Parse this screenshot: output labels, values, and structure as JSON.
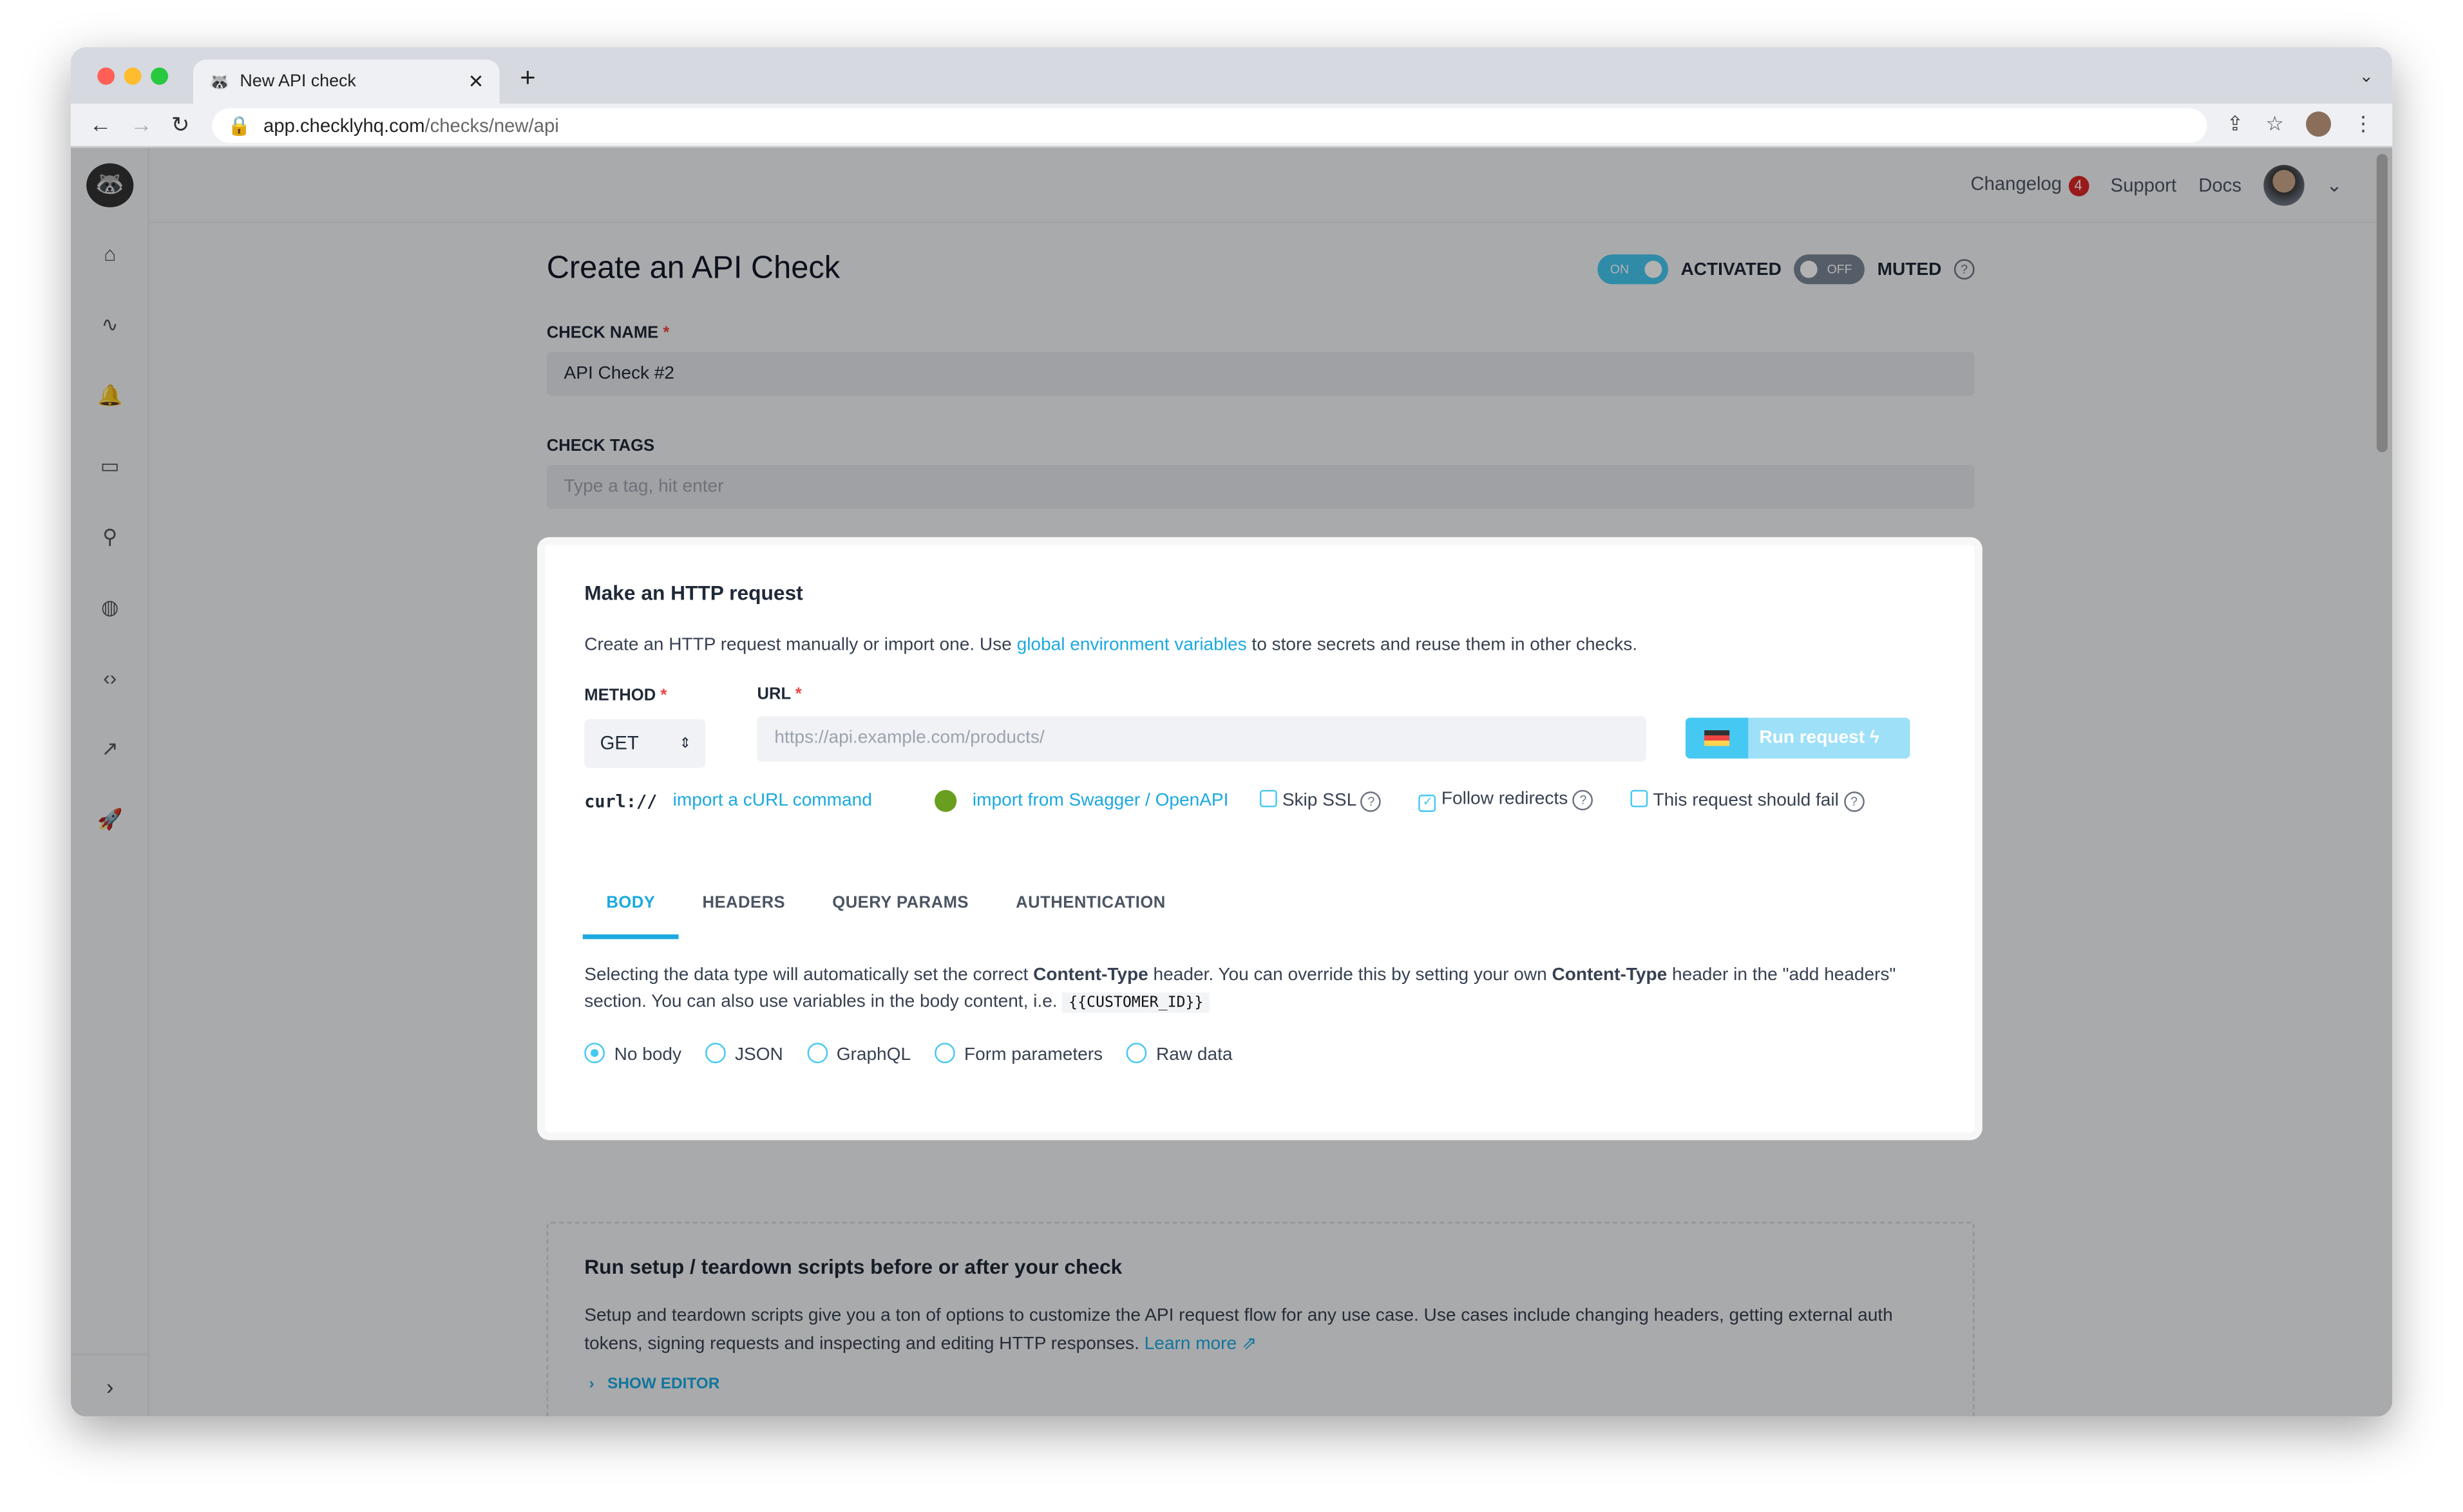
{
  "browser": {
    "tab_title": "New API check",
    "url_host": "app.checklyhq.com",
    "url_path": "/checks/new/api"
  },
  "topbar": {
    "changelog": "Changelog",
    "changelog_count": "4",
    "support": "Support",
    "docs": "Docs"
  },
  "page": {
    "title": "Create an API Check",
    "activated_toggle": "ON",
    "activated_label": "ACTIVATED",
    "muted_toggle": "OFF",
    "muted_label": "MUTED",
    "check_name_label": "CHECK NAME",
    "check_name_value": "API Check #2",
    "check_tags_label": "CHECK TAGS",
    "check_tags_placeholder": "Type a tag, hit enter"
  },
  "http": {
    "title": "Make an HTTP request",
    "desc_pre": "Create an HTTP request manually or import one. Use ",
    "desc_link": "global environment variables",
    "desc_post": " to store secrets and reuse them in other checks.",
    "method_label": "METHOD",
    "method_value": "GET",
    "url_label": "URL",
    "url_placeholder": "https://api.example.com/products/",
    "run_label": "Run request",
    "curl_logo": "curl://",
    "import_curl": "import a cURL command",
    "import_swagger": "import from Swagger / OpenAPI",
    "skip_ssl": "Skip SSL",
    "skip_ssl_checked": false,
    "follow_redirects": "Follow redirects",
    "follow_redirects_checked": true,
    "should_fail": "This request should fail",
    "should_fail_checked": false,
    "tabs": [
      "BODY",
      "HEADERS",
      "QUERY PARAMS",
      "AUTHENTICATION"
    ],
    "active_tab": "BODY",
    "body_p1": "Selecting the data type will automatically set the correct ",
    "body_b1": "Content-Type",
    "body_p2": " header. You can override this by setting your own ",
    "body_b2": "Content-Type",
    "body_p3": " header in the \"add headers\" section. You can also use variables in the body content, i.e. ",
    "body_code": "{{CUSTOMER_ID}}",
    "body_types": [
      "No body",
      "JSON",
      "GraphQL",
      "Form parameters",
      "Raw data"
    ],
    "selected_body_type": "No body"
  },
  "setup": {
    "title": "Run setup / teardown scripts before or after your check",
    "desc": "Setup and teardown scripts give you a ton of options to customize the API request flow for any use case. Use cases include changing headers, getting external auth tokens, signing requests and inspecting and editing HTTP responses. ",
    "learn_more": "Learn more",
    "show_editor": "SHOW EDITOR"
  },
  "colors": {
    "accent": "#45c8f1",
    "link": "#1ba9e0",
    "badge": "#dc2626"
  }
}
